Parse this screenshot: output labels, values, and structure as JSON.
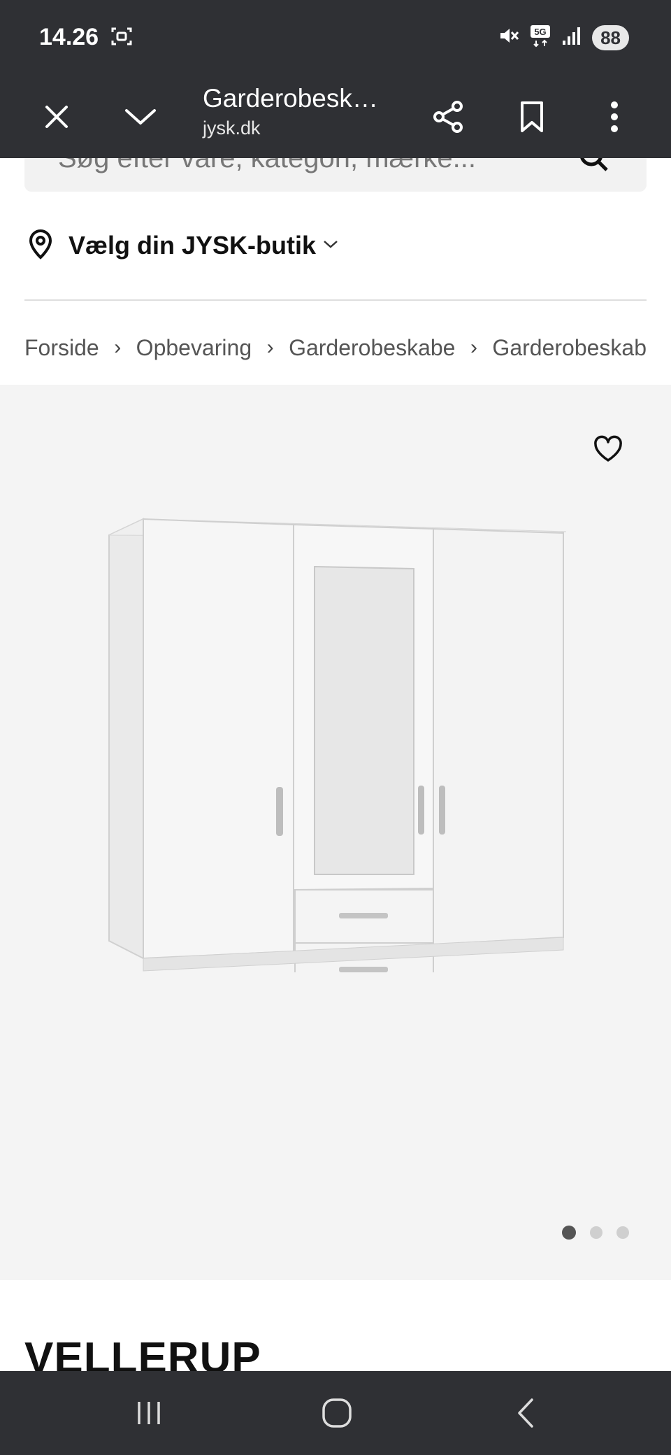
{
  "status": {
    "time": "14.26",
    "battery": "88"
  },
  "toolbar": {
    "page_title": "Garderobesk…",
    "domain": "jysk.dk"
  },
  "search": {
    "placeholder": "Søg efter vare, kategori, mærke..."
  },
  "store": {
    "label": "Vælg din JYSK-butik"
  },
  "breadcrumb": [
    "Forside",
    "Opbevaring",
    "Garderobeskabe",
    "Garderobeskab"
  ],
  "gallery": {
    "pages": 3,
    "current_page": 1
  },
  "product": {
    "name": "VELLERUP"
  },
  "colors": {
    "chrome_bg": "#2f3034",
    "gallery_bg": "#f4f4f4"
  }
}
